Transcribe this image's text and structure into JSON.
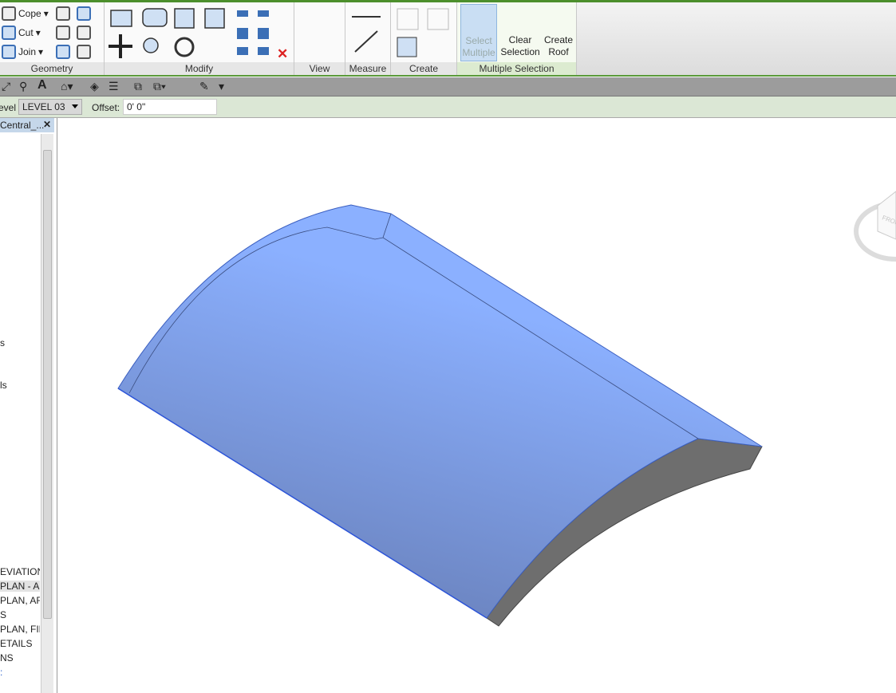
{
  "ribbon": {
    "geometry": {
      "title": "Geometry",
      "cope": "Cope",
      "cut": "Cut",
      "join": "Join"
    },
    "modify": {
      "title": "Modify"
    },
    "view": {
      "title": "View"
    },
    "measure": {
      "title": "Measure"
    },
    "create": {
      "title": "Create"
    },
    "multiple_selection": {
      "title": "Multiple Selection",
      "select_multiple": [
        "Select",
        "Multiple"
      ],
      "clear_selection": [
        "Clear",
        "Selection"
      ],
      "create_roof": [
        "Create",
        "Roof"
      ]
    }
  },
  "options": {
    "level_label": "Level:",
    "level_value": "LEVEL 03",
    "offset_label": "Offset:",
    "offset_value": "0'  0\""
  },
  "browser": {
    "tab": "Central_...",
    "items": [
      "s",
      "ls",
      "EVIATION",
      "PLAN - AI",
      "PLAN, AR",
      "S",
      "PLAN, FIR",
      "ETAILS",
      "NS",
      ":"
    ]
  },
  "viewcube": {
    "face": "FRONT"
  },
  "colors": {
    "roof_top": "#8aabf5",
    "roof_edge": "#6a6a6a",
    "accent": "#4c8f2c"
  }
}
